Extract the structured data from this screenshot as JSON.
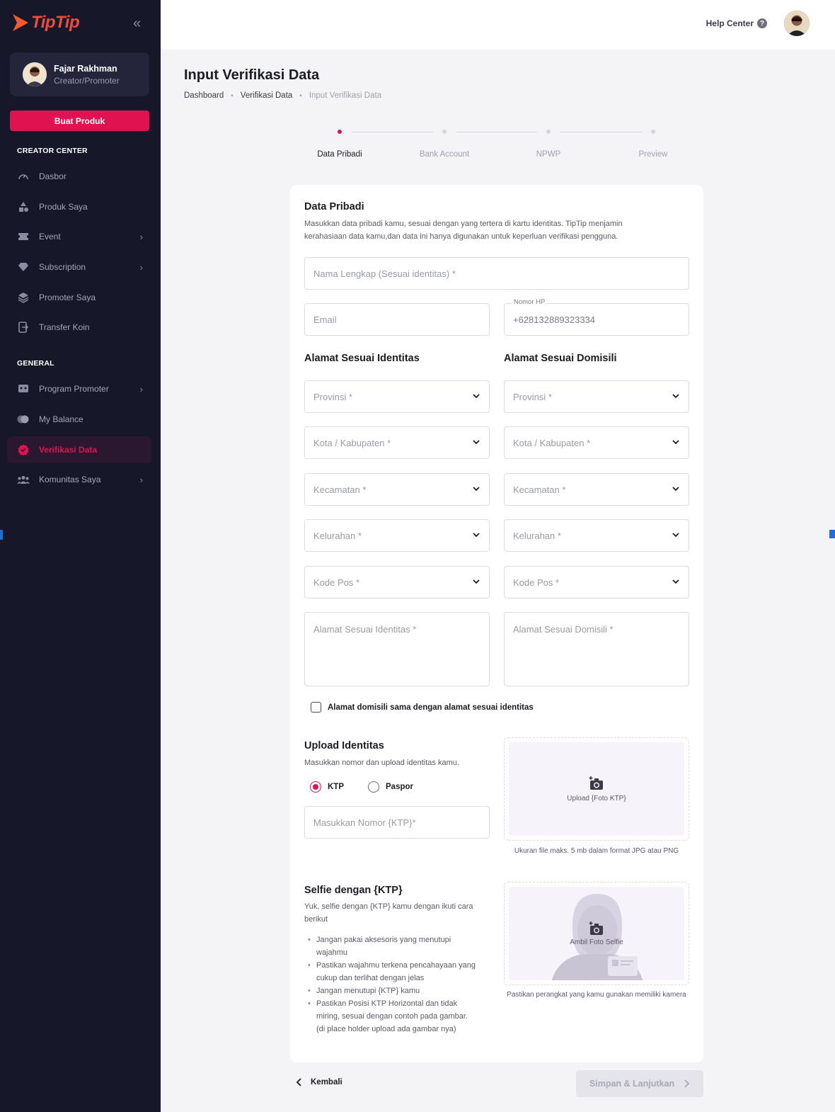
{
  "brand": {
    "name": "TipTip",
    "accent": "#e0124f"
  },
  "sidebar": {
    "user": {
      "name": "Fajar Rakhman",
      "role": "Creator/Promoter"
    },
    "create_button": "Buat Produk",
    "section_creator": "CREATOR CENTER",
    "section_general": "GENERAL",
    "creator_items": [
      {
        "label": "Dasbor",
        "icon": "speedometer-icon"
      },
      {
        "label": "Produk Saya",
        "icon": "shapes-icon"
      },
      {
        "label": "Event",
        "icon": "ticket-icon"
      },
      {
        "label": "Subscription",
        "icon": "diamond-icon"
      },
      {
        "label": "Promoter Saya",
        "icon": "layers-icon"
      },
      {
        "label": "Transfer Koin",
        "icon": "transfer-icon"
      }
    ],
    "general_items": [
      {
        "label": "Program Promoter",
        "icon": "robot-icon"
      },
      {
        "label": "My Balance",
        "icon": "coins-icon"
      },
      {
        "label": "Verifikasi Data",
        "icon": "verified-badge-icon"
      },
      {
        "label": "Komunitas Saya",
        "icon": "community-icon"
      }
    ]
  },
  "topbar": {
    "help_label": "Help Center"
  },
  "page": {
    "title": "Input Verifikasi Data",
    "breadcrumb": [
      "Dashboard",
      "Verifikasi Data",
      "Input Verifikasi Data"
    ]
  },
  "stepper": {
    "steps": [
      "Data Pribadi",
      "Bank Account",
      "NPWP",
      "Preview"
    ],
    "active": 0
  },
  "form": {
    "title": "Data Pribadi",
    "description_1": "Masukkan data pribadi kamu, sesuai dengan yang tertera di kartu identitas. TipTip menjamin",
    "description_2": "kerahasiaan data kamu,dan data ini hanya digunakan untuk keperluan verifikasi pengguna.",
    "full_name_placeholder": "Nama Lengkap (Sesuai identitas) *",
    "email_placeholder": "Email",
    "phone_label": "Nomor HP",
    "phone_value": "+628132889323334",
    "id_address_title": "Alamat Sesuai Identitas",
    "dom_address_title": "Alamat Sesuai Domisili",
    "selects": [
      "Provinsi *",
      "Kota / Kabupaten *",
      "Kecamatan *",
      "Kelurahan *",
      "Kode Pos *"
    ],
    "id_address_placeholder": "Alamat Sesuai Identitas *",
    "dom_address_placeholder": "Alamat Sesuai Domisili *",
    "same_address_label": "Alamat domisili sama dengan alamat sesuai identitas",
    "upload_title": "Upload Identitas",
    "upload_desc": "Masukkan nomor dan upload identitas kamu.",
    "radio_ktp": "KTP",
    "radio_paspor": "Paspor",
    "id_number_placeholder": "Masukkan Nomor {KTP}*",
    "upload_label": "Upload {Foto KTP}",
    "upload_note": "Ukuran file maks. 5 mb dalam format JPG atau PNG",
    "selfie_title": "Selfie dengan {KTP}",
    "selfie_desc_1": "Yuk, selfie dengan {KTP} kamu dengan ikuti cara",
    "selfie_desc_2": "berikut",
    "selfie_rules": [
      [
        "Jangan pakai aksesoris yang menutupi",
        "wajahmu"
      ],
      [
        "Pastikan wajahmu terkena pencahayaan yang",
        "cukup dan terlihat dengan jelas"
      ],
      [
        "Jangan menutupi {KTP} kamu"
      ],
      [
        "Pastikan Posisi KTP Horizontal dan tidak",
        "miring, sesuai dengan contoh pada gambar.",
        "(di place holder upload ada gambar nya)"
      ]
    ],
    "selfie_label": "Ambil Foto Selfie",
    "selfie_note": "Pastikan perangkat yang kamu gunakan memiliki kamera"
  },
  "actions": {
    "back_label": "Kembali",
    "next_label": "Simpan & Lanjutkan"
  }
}
